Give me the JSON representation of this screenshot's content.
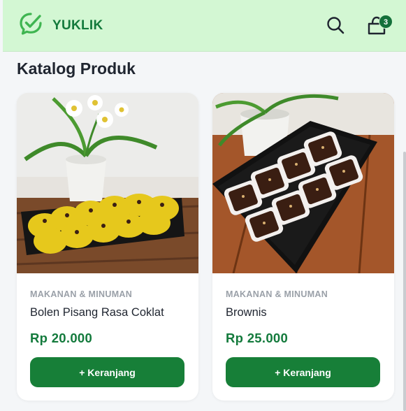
{
  "header": {
    "brand": "YUKLIK",
    "cart_count": "3",
    "logo_icon": "check-chat-bubble-icon",
    "search_icon": "search-icon",
    "cart_icon": "cart-icon",
    "accent_color": "#137a3c",
    "header_bg": "#d3f7d3"
  },
  "main": {
    "title": "Katalog Produk",
    "products": [
      {
        "category": "MAKANAN & MINUMAN",
        "name": "Bolen Pisang Rasa Coklat",
        "price": "Rp 20.000",
        "add_label": "+ Keranjang"
      },
      {
        "category": "MAKANAN & MINUMAN",
        "name": "Brownis",
        "price": "Rp 25.000",
        "add_label": "+ Keranjang"
      }
    ]
  }
}
